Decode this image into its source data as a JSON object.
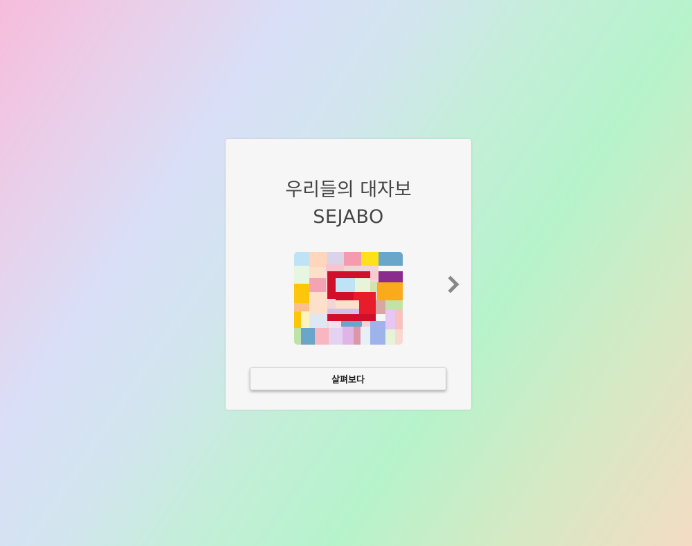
{
  "card": {
    "title_line1": "우리들의 대자보",
    "title_line2": "SEJABO",
    "thumbnail_alt": "대자보 썸네일",
    "next_icon": "chevron-right-icon",
    "explore_button_label": "살펴보다"
  },
  "colors": {
    "card_background": "#f6f6f6",
    "title_text": "#444444",
    "arrow": "#888888"
  }
}
